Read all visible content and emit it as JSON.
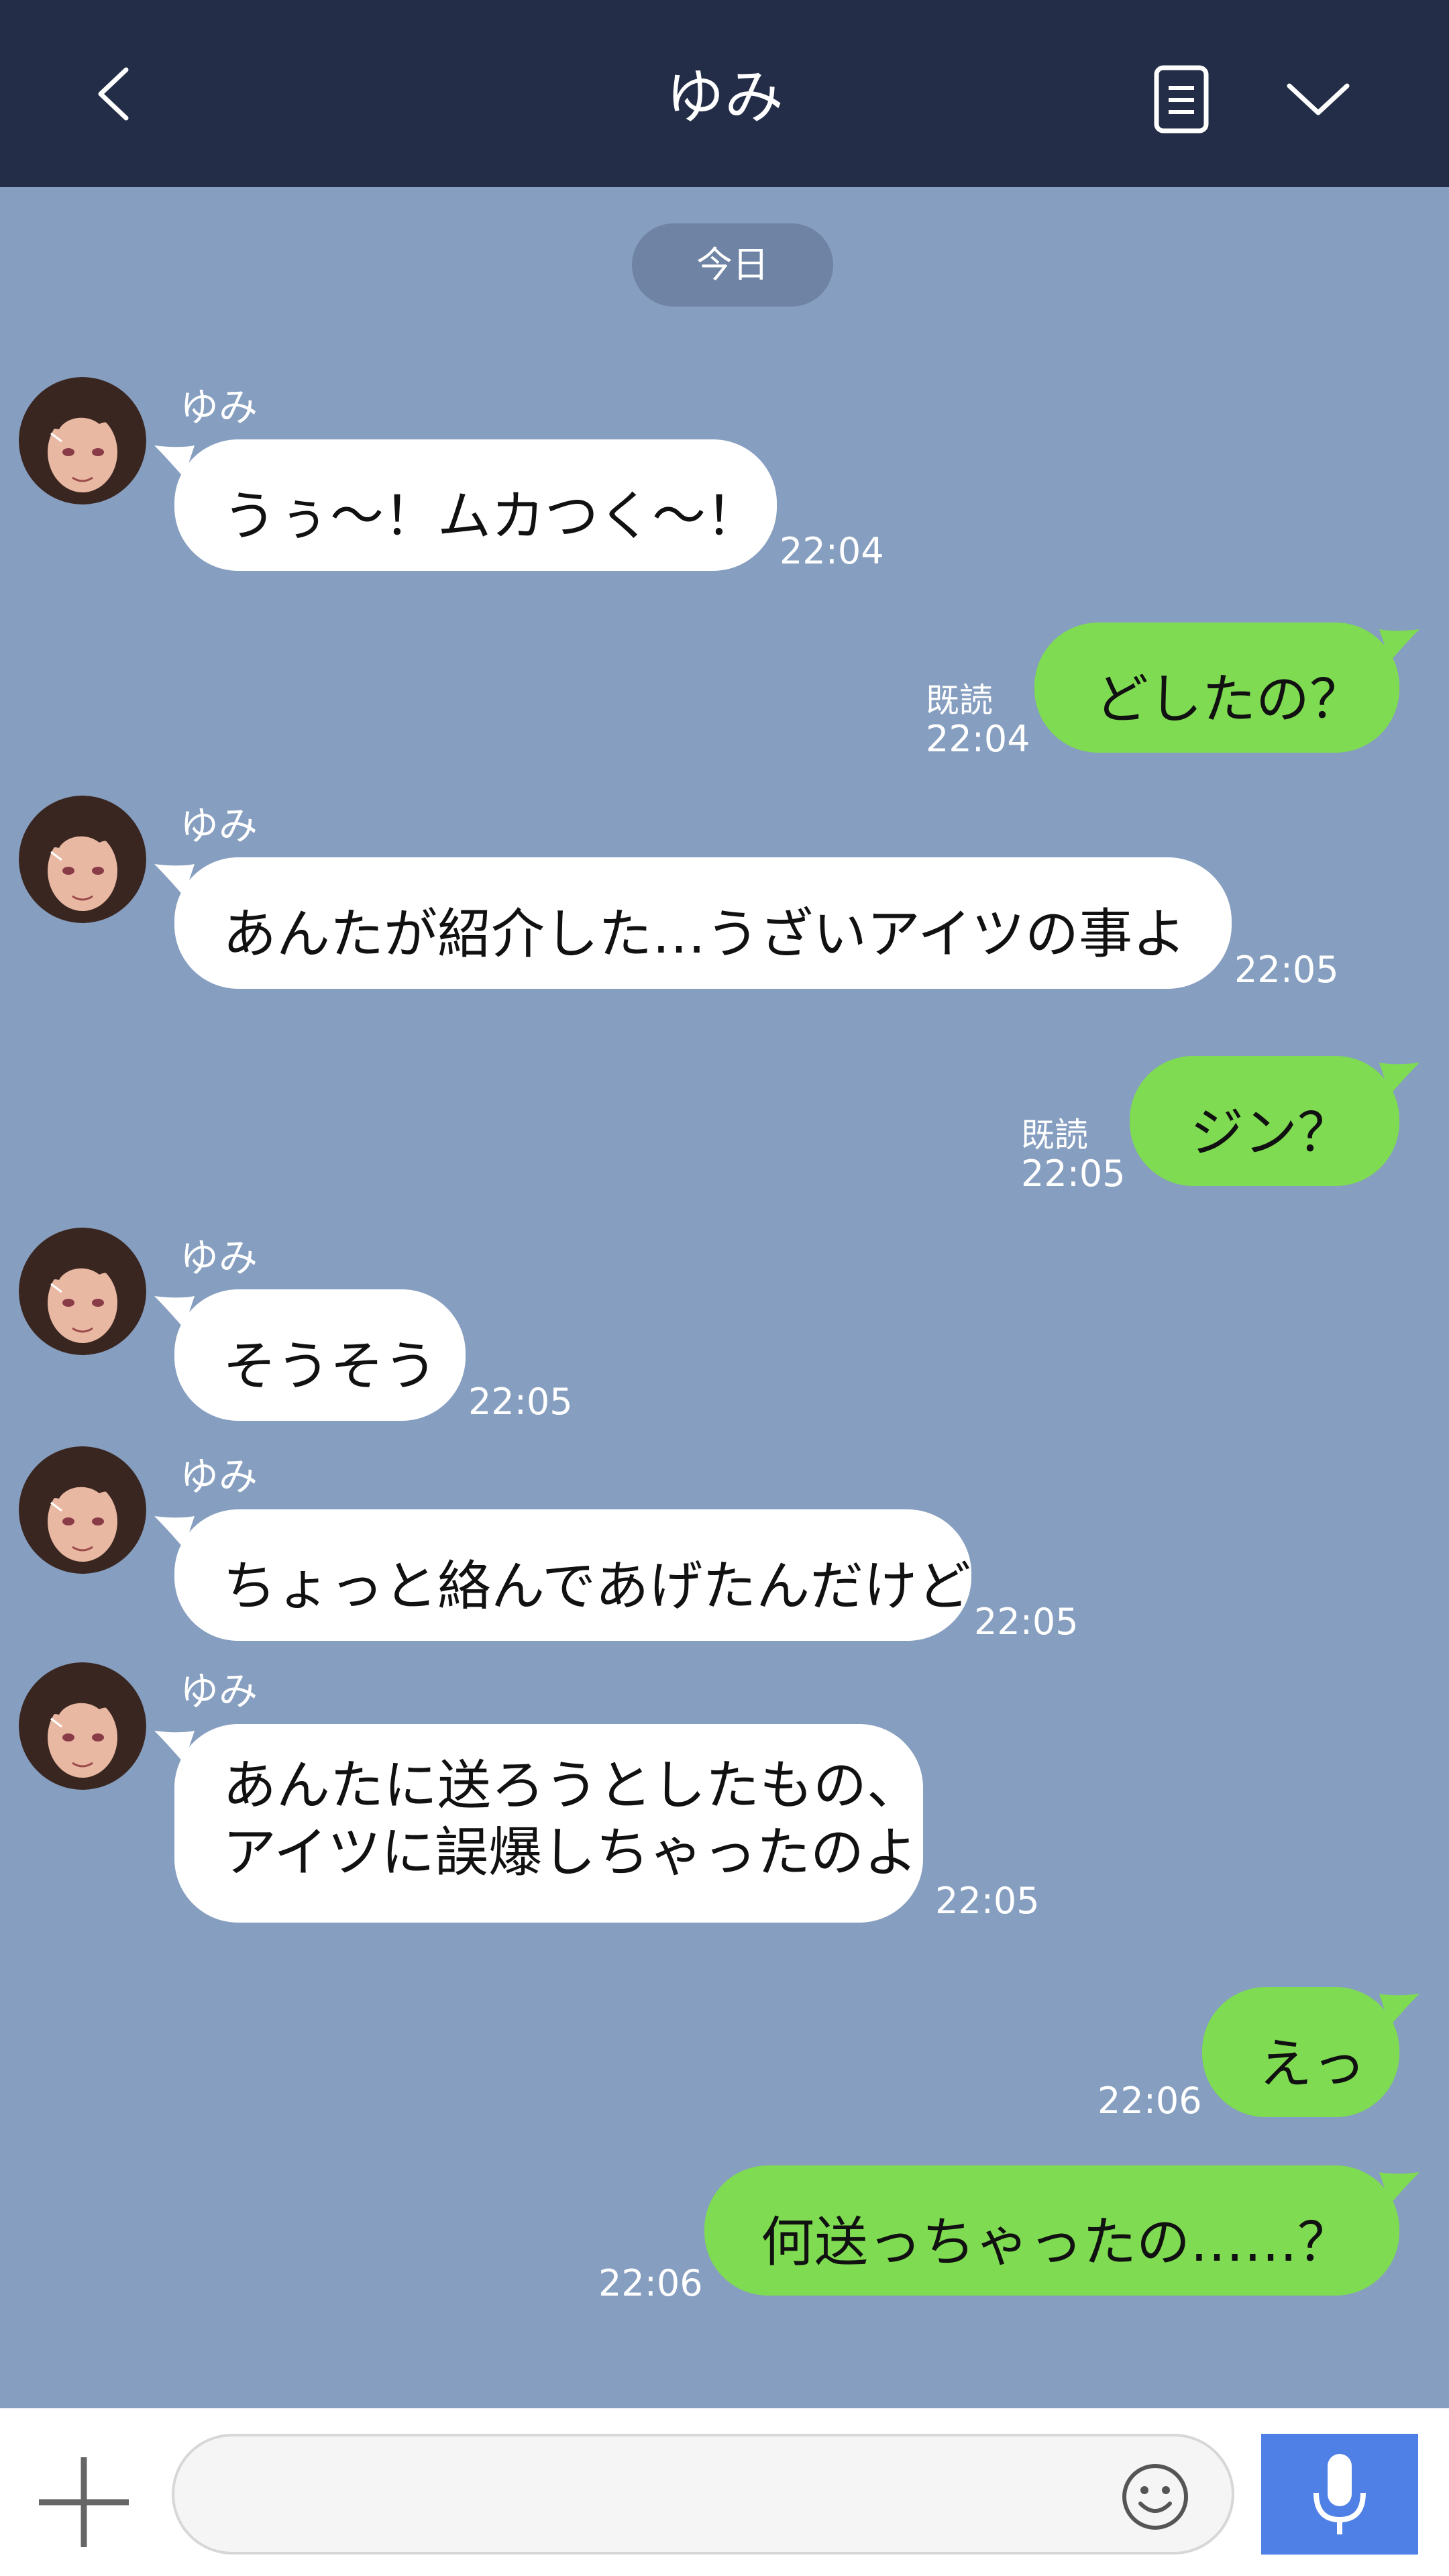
{
  "header": {
    "title": "ゆみ",
    "icons": [
      "back-chevron-icon",
      "notes-icon",
      "chevron-down-icon"
    ]
  },
  "date_separator": "今日",
  "messages": [
    {
      "side": "in",
      "sender": "ゆみ",
      "lines": [
        "うぅ〜！ムカつく〜！"
      ],
      "time": "22:04"
    },
    {
      "side": "out",
      "read": "既読",
      "lines": [
        "どしたの？"
      ],
      "time": "22:04"
    },
    {
      "side": "in",
      "sender": "ゆみ",
      "lines": [
        "あんたが紹介した…うざいアイツの事よ"
      ],
      "time": "22:05"
    },
    {
      "side": "out",
      "read": "既読",
      "lines": [
        "ジン？"
      ],
      "time": "22:05"
    },
    {
      "side": "in",
      "sender": "ゆみ",
      "lines": [
        "そうそう"
      ],
      "time": "22:05"
    },
    {
      "side": "in",
      "sender": "ゆみ",
      "lines": [
        "ちょっと絡んであげたんだけど"
      ],
      "time": "22:05"
    },
    {
      "side": "in",
      "sender": "ゆみ",
      "lines": [
        "あんたに送ろうとしたもの、",
        "アイツに誤爆しちゃったのよ"
      ],
      "time": "22:05"
    },
    {
      "side": "out",
      "lines": [
        "えっ"
      ],
      "time": "22:06"
    },
    {
      "side": "out",
      "lines": [
        "何送っちゃったの……？"
      ],
      "time": "22:06"
    }
  ],
  "composer": {
    "placeholder": "",
    "icons": [
      "plus-icon",
      "emoji-icon",
      "microphone-icon"
    ]
  },
  "colors": {
    "header_bg": "#232d47",
    "chat_bg": "#869ebf",
    "incoming_bubble": "#ffffff",
    "outgoing_bubble": "#7fdb51",
    "date_chip": "#6f84a4",
    "mic_button": "#4f80e6"
  }
}
